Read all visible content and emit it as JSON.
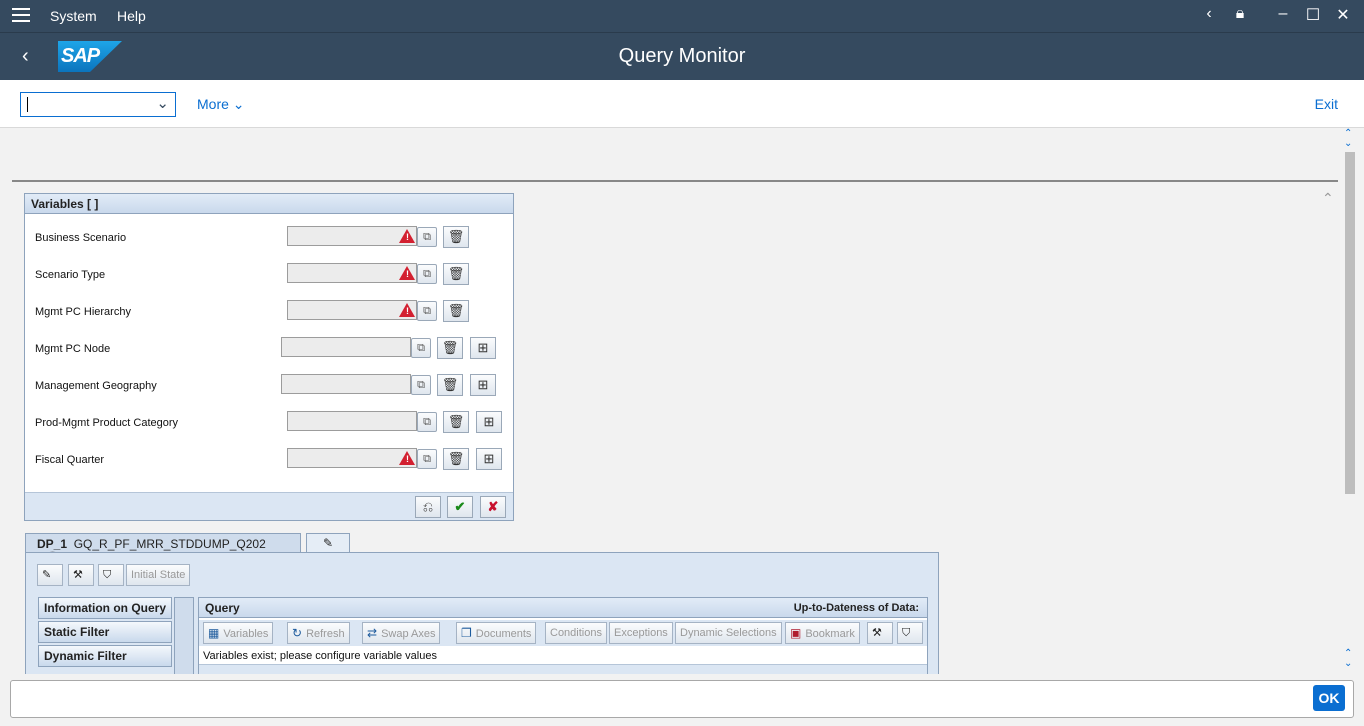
{
  "titlebar": {
    "menu_system": "System",
    "menu_help": "Help"
  },
  "header": {
    "logo_text": "SAP",
    "title": "Query Monitor"
  },
  "toolbar": {
    "more_label": "More",
    "exit_label": "Exit"
  },
  "variables_panel": {
    "title": "Variables [ ]",
    "rows": [
      {
        "label": "Business Scenario"
      },
      {
        "label": "Scenario Type"
      },
      {
        "label": "Mgmt PC Hierarchy"
      },
      {
        "label": "Mgmt PC Node"
      },
      {
        "label": "Management Geography"
      },
      {
        "label": "Prod-Mgmt Product Category"
      },
      {
        "label": "Fiscal Quarter"
      }
    ]
  },
  "dataprovider": {
    "tab_id": "DP_1",
    "tab_query": "GQ_R_PF_MRR_STDDUMP_Q202",
    "initial_state_label": "Initial State",
    "nav": [
      "Information on Query",
      "Static Filter",
      "Dynamic Filter"
    ],
    "query": {
      "title": "Query",
      "up_to_date_label": "Up-to-Dateness of Data:",
      "buttons": [
        "Variables",
        "Refresh",
        "Swap Axes",
        "Documents",
        "Conditions",
        "Exceptions",
        "Dynamic Selections",
        "Bookmark"
      ],
      "message": "Variables exist; please configure variable values"
    }
  },
  "footer": {
    "ok_label": "OK"
  },
  "colors": {
    "shell": "#354a5f",
    "accent": "#0a6ed1",
    "warning": "#d32030"
  }
}
